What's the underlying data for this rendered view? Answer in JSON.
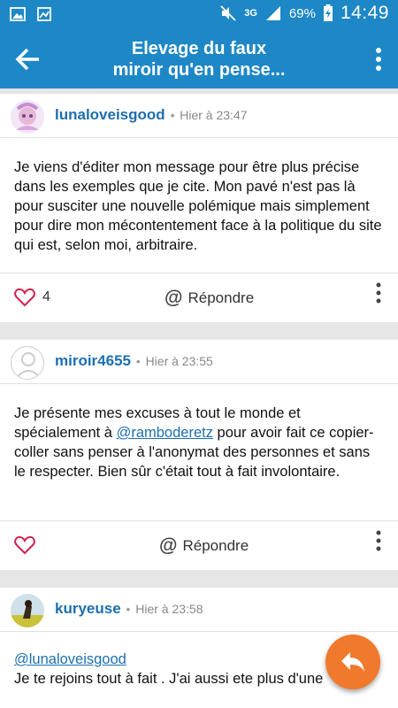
{
  "status_bar": {
    "network": "3G",
    "battery": "69%",
    "time": "14:49"
  },
  "header": {
    "title_line1": "Elevage du faux",
    "title_line2": "miroir qu'en pense..."
  },
  "posts": [
    {
      "author": "lunaloveisgood",
      "time": "Hier à 23:47",
      "body": "Je viens d'éditer mon message pour être plus précise dans les exemples que je cite. Mon pavé n'est pas là pour susciter une nouvelle polémique mais simplement pour dire mon mécontentement face à la politique du site qui est, selon moi, arbitraire.",
      "likes": "4",
      "reply_label": "Répondre"
    },
    {
      "author": "miroir4655",
      "time": "Hier à 23:55",
      "body_before": "Je présente mes excuses à tout le monde et spécialement à ",
      "mention": "@ramboderetz",
      "body_after": " pour avoir fait ce copier-coller sans penser à l'anonymat des personnes et sans le respecter. Bien sûr c'était tout à fait involontaire.",
      "likes": "",
      "reply_label": "Répondre"
    },
    {
      "author": "kuryeuse",
      "time": "Hier à 23:58",
      "mention": "@lunaloveisgood",
      "body": "Je te rejoins tout à fait . J'ai aussi ete plus d'une"
    }
  ],
  "icons": {
    "back": "arrow-left-icon",
    "menu": "more-vert-icon",
    "like": "heart-outline-icon",
    "reply": "at-icon",
    "fab": "reply-icon"
  },
  "colors": {
    "primary": "#1e88c7",
    "author": "#1c6fb1",
    "heart": "#d2214f",
    "fab": "#f0792c"
  }
}
